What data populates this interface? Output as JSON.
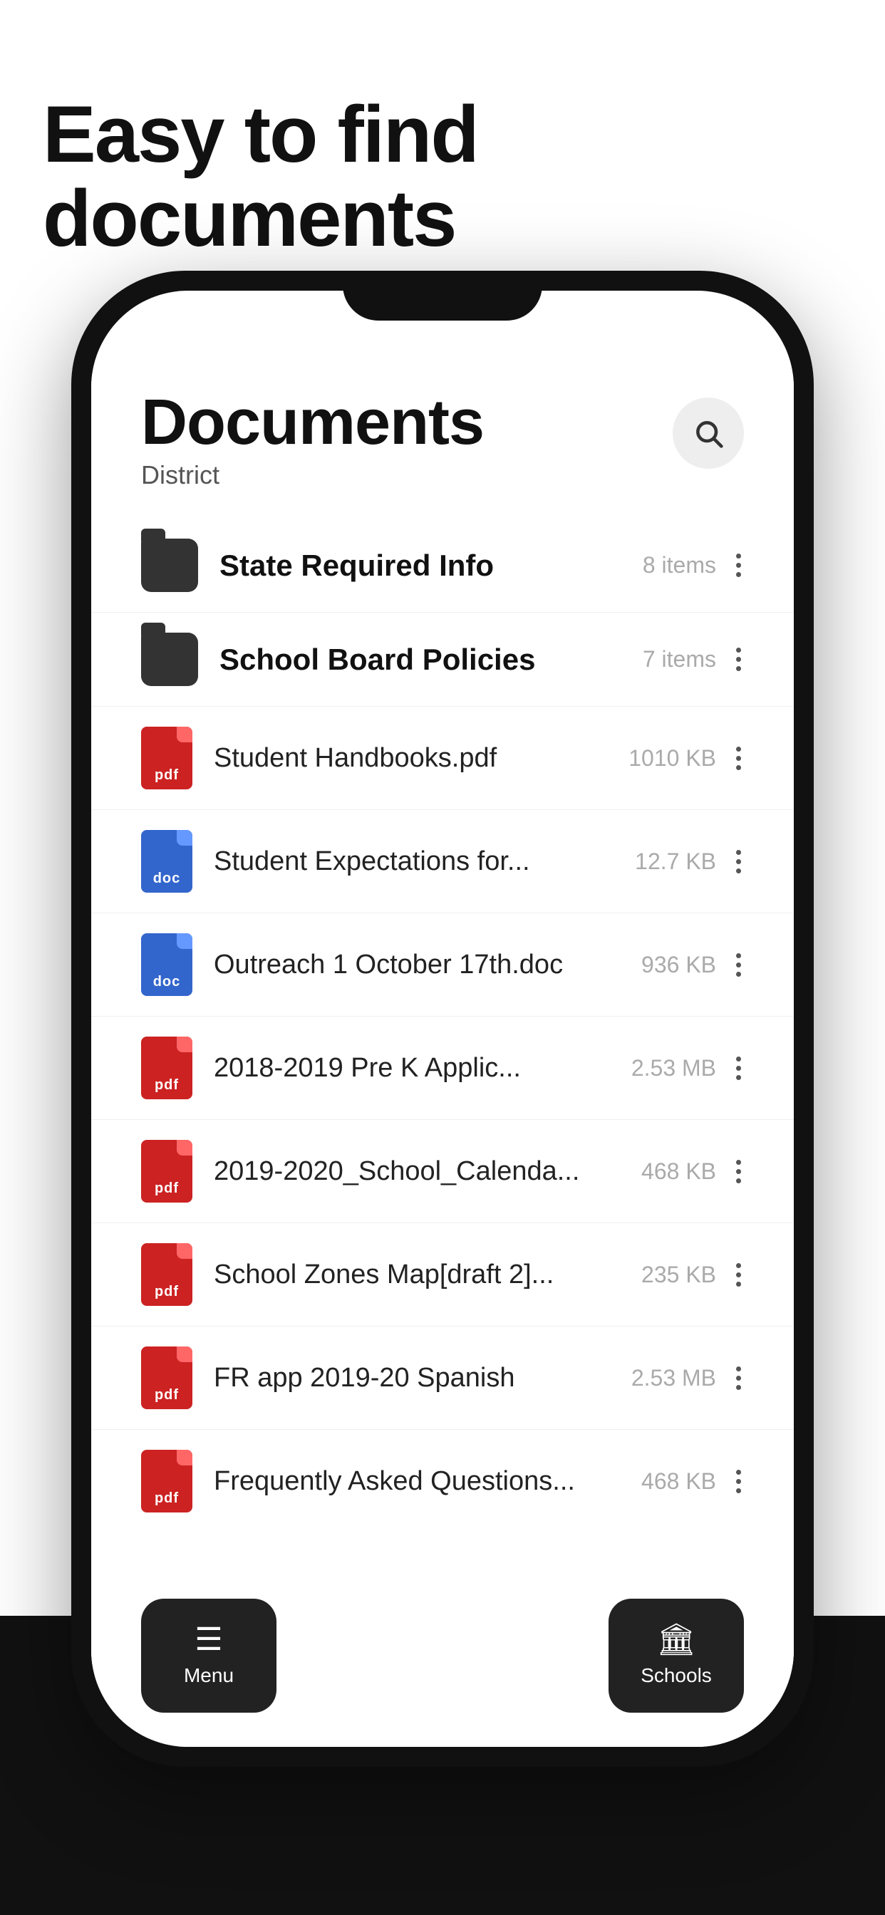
{
  "page": {
    "headline": "Easy to find documents",
    "screen": {
      "title": "Documents",
      "subtitle": "District",
      "search_button_label": "search"
    },
    "folders": [
      {
        "name": "State Required Info",
        "meta": "8 items",
        "type": "folder"
      },
      {
        "name": "School Board Policies",
        "meta": "7 items",
        "type": "folder"
      }
    ],
    "files": [
      {
        "name": "Student Handbooks.pdf",
        "size": "1010 KB",
        "type": "pdf"
      },
      {
        "name": "Student Expectations for...",
        "size": "12.7 KB",
        "type": "doc"
      },
      {
        "name": "Outreach 1 October 17th.doc",
        "size": "936 KB",
        "type": "doc"
      },
      {
        "name": "2018-2019 Pre K Applic...",
        "size": "2.53 MB",
        "type": "pdf"
      },
      {
        "name": "2019-2020_School_Calenda...",
        "size": "468 KB",
        "type": "pdf"
      },
      {
        "name": "School Zones Map[draft 2]...",
        "size": "235 KB",
        "type": "pdf"
      },
      {
        "name": "FR app 2019-20 Spanish",
        "size": "2.53 MB",
        "type": "pdf"
      },
      {
        "name": "Frequently Asked Questions...",
        "size": "468 KB",
        "type": "pdf"
      }
    ],
    "nav": {
      "menu_label": "Menu",
      "schools_label": "Schools"
    }
  }
}
